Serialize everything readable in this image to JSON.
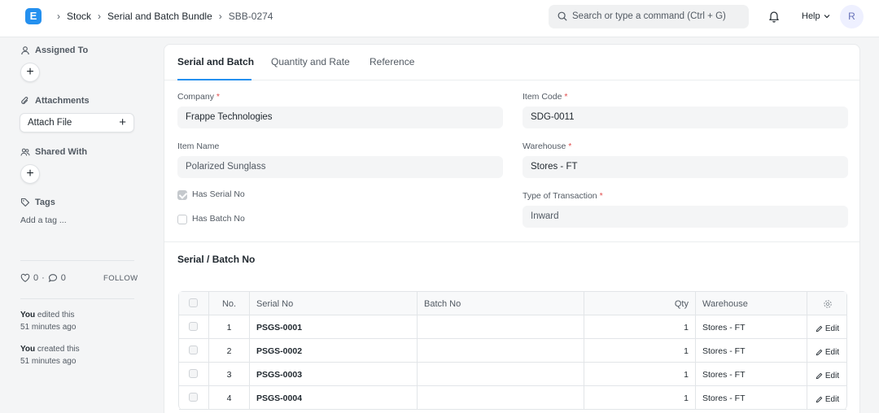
{
  "navbar": {
    "logo_letter": "E",
    "breadcrumbs": [
      "Stock",
      "Serial and Batch Bundle",
      "SBB-0274"
    ],
    "search_placeholder": "Search or type a command (Ctrl + G)",
    "help_label": "Help",
    "avatar_initial": "R"
  },
  "sidebar": {
    "assigned_to": "Assigned To",
    "attachments": "Attachments",
    "attach_file": "Attach File",
    "shared_with": "Shared With",
    "tags": "Tags",
    "add_tag": "Add a tag ...",
    "likes_count": "0",
    "comments_count": "0",
    "follow": "FOLLOW",
    "activity": [
      {
        "who": "You",
        "action": " edited this",
        "when": "51 minutes ago"
      },
      {
        "who": "You",
        "action": " created this",
        "when": "51 minutes ago"
      }
    ]
  },
  "tabs": [
    "Serial and Batch",
    "Quantity and Rate",
    "Reference"
  ],
  "form": {
    "company_label": "Company",
    "company_value": "Frappe Technologies",
    "item_code_label": "Item Code",
    "item_code_value": "SDG-0011",
    "item_name_label": "Item Name",
    "item_name_value": "Polarized Sunglass",
    "warehouse_label": "Warehouse",
    "warehouse_value": "Stores - FT",
    "has_serial_label": "Has Serial No",
    "has_batch_label": "Has Batch No",
    "type_label": "Type of Transaction",
    "type_value": "Inward",
    "required_mark": "*"
  },
  "section_title": "Serial / Batch No",
  "table": {
    "headers": {
      "no": "No.",
      "serial": "Serial No",
      "batch": "Batch No",
      "qty": "Qty",
      "warehouse": "Warehouse"
    },
    "edit_label": "Edit",
    "rows": [
      {
        "no": "1",
        "serial": "PSGS-0001",
        "batch": "",
        "qty": "1",
        "warehouse": "Stores - FT"
      },
      {
        "no": "2",
        "serial": "PSGS-0002",
        "batch": "",
        "qty": "1",
        "warehouse": "Stores - FT"
      },
      {
        "no": "3",
        "serial": "PSGS-0003",
        "batch": "",
        "qty": "1",
        "warehouse": "Stores - FT"
      },
      {
        "no": "4",
        "serial": "PSGS-0004",
        "batch": "",
        "qty": "1",
        "warehouse": "Stores - FT"
      }
    ]
  }
}
